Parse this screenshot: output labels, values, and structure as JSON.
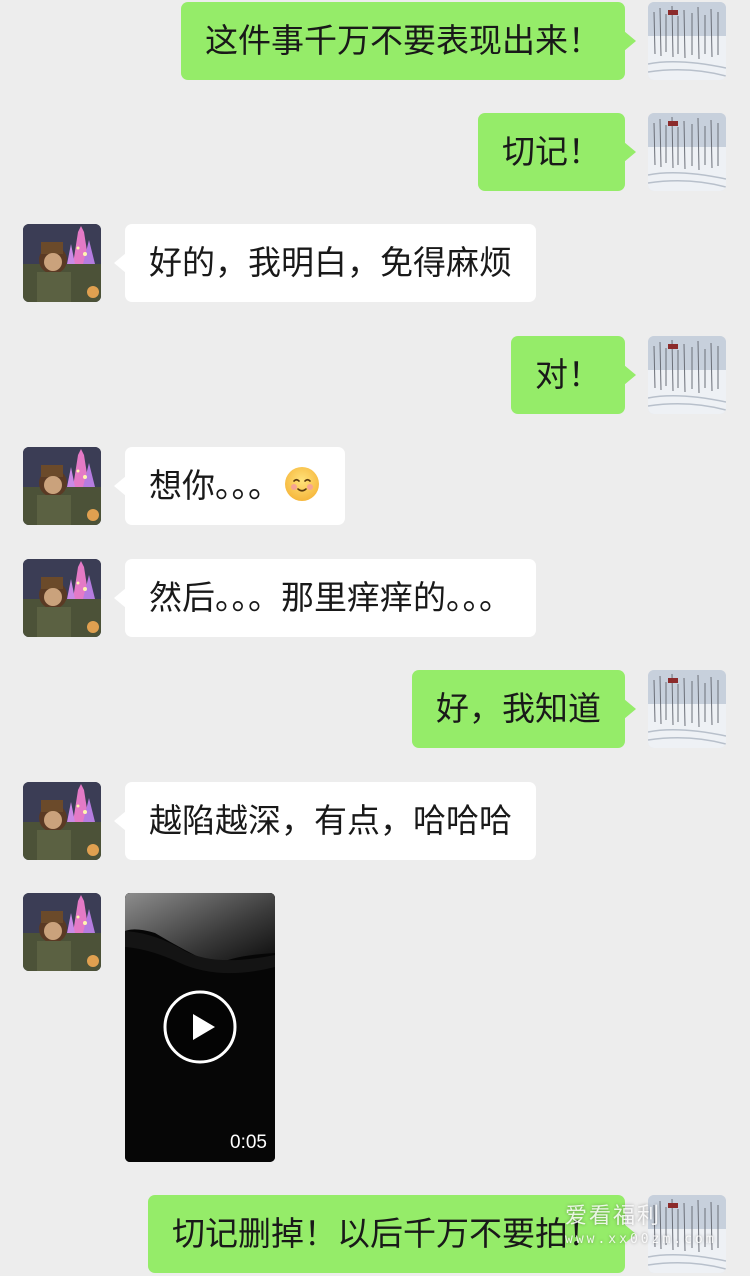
{
  "conversation": {
    "messages": [
      {
        "side": "out",
        "text": "这件事千万不要表现出来！"
      },
      {
        "side": "out",
        "text": "切记！"
      },
      {
        "side": "in",
        "text": "好的，我明白，免得麻烦"
      },
      {
        "side": "out",
        "text": "对！"
      },
      {
        "side": "in",
        "text": "想你。。。",
        "emoji": "smiling-face-emoji"
      },
      {
        "side": "in",
        "text": "然后。。。那里痒痒的。。。"
      },
      {
        "side": "out",
        "text": "好，我知道"
      },
      {
        "side": "in",
        "text": "越陷越深，有点，哈哈哈"
      },
      {
        "side": "in",
        "type": "video",
        "duration": "0:05"
      },
      {
        "side": "out",
        "text": "切记删掉！以后千万不要拍！"
      }
    ]
  },
  "avatars": {
    "self": "snow-forest-avatar",
    "contact": "castle-night-avatar"
  },
  "watermark": {
    "text": "爱看福利",
    "sub": "www.xx00zm.com"
  },
  "colors": {
    "background": "#ededed",
    "outgoing_bubble": "#95ec69",
    "incoming_bubble": "#ffffff"
  }
}
